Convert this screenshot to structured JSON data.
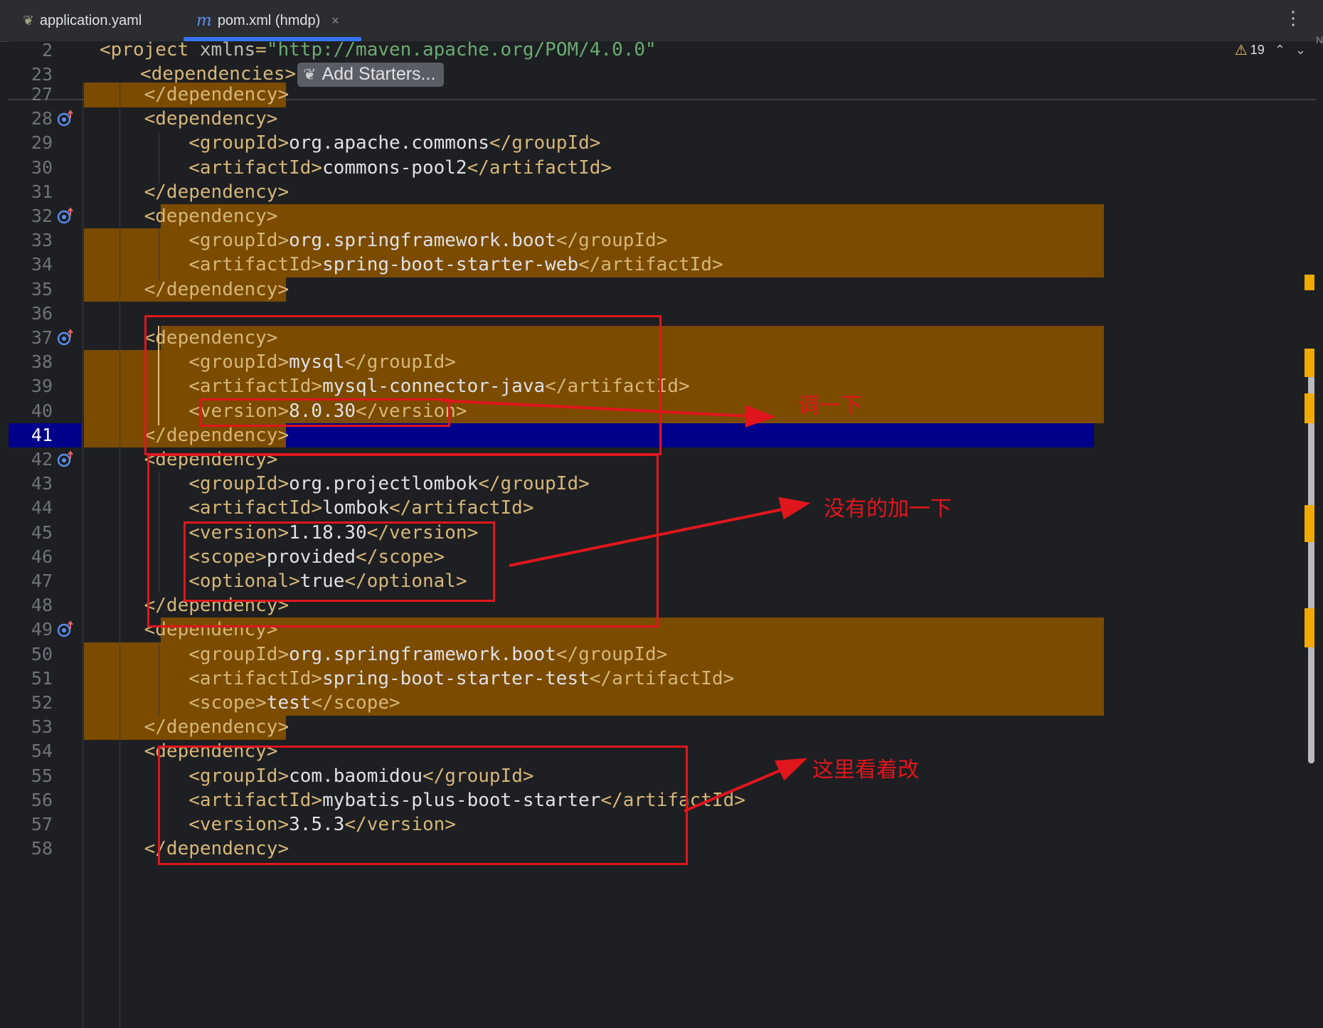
{
  "tabs": [
    {
      "label": "application.yaml",
      "icon": "leaf-file-icon"
    },
    {
      "label": "pom.xml (hmdp)",
      "icon": "maven-m-icon",
      "close": "×"
    }
  ],
  "menu_glyph": "⋮",
  "corner_letter": "N",
  "warnings": {
    "count": "19",
    "up": "⌃",
    "down": "⌄"
  },
  "add_starters": "Add Starters...",
  "sticky": [
    {
      "n": "2",
      "t": "project_line"
    },
    {
      "n": "23",
      "t": "dependencies_line"
    }
  ],
  "project_line": {
    "tag_open": "<project ",
    "attr": "xmlns",
    "eq": "=",
    "value": "\"http://maven.apache.org/POM/4.0.0\""
  },
  "dependencies_open": "<dependencies>",
  "lines": [
    {
      "n": "27",
      "code": "    </dependency>"
    },
    {
      "n": "28",
      "code": "    <dependency>"
    },
    {
      "n": "29",
      "code": "        <groupId>org.apache.commons</groupId>"
    },
    {
      "n": "30",
      "code": "        <artifactId>commons-pool2</artifactId>"
    },
    {
      "n": "31",
      "code": "    </dependency>"
    },
    {
      "n": "32",
      "code": "    <dependency>"
    },
    {
      "n": "33",
      "code": "        <groupId>org.springframework.boot</groupId>"
    },
    {
      "n": "34",
      "code": "        <artifactId>spring-boot-starter-web</artifactId>"
    },
    {
      "n": "35",
      "code": "    </dependency>"
    },
    {
      "n": "36",
      "code": ""
    },
    {
      "n": "37",
      "code": "    <dependency>"
    },
    {
      "n": "38",
      "code": "        <groupId>mysql</groupId>"
    },
    {
      "n": "39",
      "code": "        <artifactId>mysql-connector-java</artifactId>"
    },
    {
      "n": "40",
      "code": "        <version>8.0.30</version>"
    },
    {
      "n": "41",
      "code": "    </dependency>"
    },
    {
      "n": "42",
      "code": "    <dependency>"
    },
    {
      "n": "43",
      "code": "        <groupId>org.projectlombok</groupId>"
    },
    {
      "n": "44",
      "code": "        <artifactId>lombok</artifactId>"
    },
    {
      "n": "45",
      "code": "        <version>1.18.30</version>"
    },
    {
      "n": "46",
      "code": "        <scope>provided</scope>"
    },
    {
      "n": "47",
      "code": "        <optional>true</optional>"
    },
    {
      "n": "48",
      "code": "    </dependency>"
    },
    {
      "n": "49",
      "code": "    <dependency>"
    },
    {
      "n": "50",
      "code": "        <groupId>org.springframework.boot</groupId>"
    },
    {
      "n": "51",
      "code": "        <artifactId>spring-boot-starter-test</artifactId>"
    },
    {
      "n": "52",
      "code": "        <scope>test</scope>"
    },
    {
      "n": "53",
      "code": "    </dependency>"
    },
    {
      "n": "54",
      "code": "    <dependency>"
    },
    {
      "n": "55",
      "code": "        <groupId>com.baomidou</groupId>"
    },
    {
      "n": "56",
      "code": "        <artifactId>mybatis-plus-boot-starter</artifactId>"
    },
    {
      "n": "57",
      "code": "        <version>3.5.3</version>"
    },
    {
      "n": "58",
      "code": "    </dependency>"
    }
  ],
  "current_line": "41",
  "annotations": [
    {
      "text": "调一下",
      "color": "#e0161d"
    },
    {
      "text": "没有的加一下",
      "color": "#e0161d"
    },
    {
      "text": "这里看着改",
      "color": "#e0161d"
    }
  ],
  "colors": {
    "background": "#1e1f22",
    "tag": "#d5b778",
    "text": "#dfe1e5",
    "string": "#6aab73",
    "highlight": "#7b4b00",
    "current_line": "#00008b",
    "annotation": "#e0161d",
    "tab_underline": "#3574f0"
  }
}
